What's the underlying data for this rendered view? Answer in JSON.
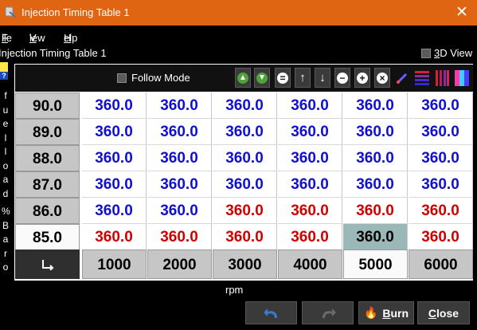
{
  "window": {
    "title": "Injection Timing Table 1"
  },
  "menu": [
    {
      "label": "File",
      "ul": "F",
      "rest": "ile"
    },
    {
      "label": "View",
      "ul": "V",
      "rest": "iew"
    },
    {
      "label": "Help",
      "ul": "H",
      "rest": "elp"
    }
  ],
  "table_name": "Injection Timing Table 1",
  "view3d": {
    "label": "3D View",
    "ul": "3",
    "rest": "D View"
  },
  "follow_mode": "Follow Mode",
  "y_axis_label": [
    "f",
    "u",
    "e",
    "l",
    "l",
    "o",
    "a",
    "d",
    "%",
    "B",
    "a",
    "r",
    "o"
  ],
  "rows": [
    {
      "label": "90.0",
      "cells": [
        "360.0",
        "360.0",
        "360.0",
        "360.0",
        "360.0",
        "360.0"
      ]
    },
    {
      "label": "89.0",
      "cells": [
        "360.0",
        "360.0",
        "360.0",
        "360.0",
        "360.0",
        "360.0"
      ]
    },
    {
      "label": "88.0",
      "cells": [
        "360.0",
        "360.0",
        "360.0",
        "360.0",
        "360.0",
        "360.0"
      ]
    },
    {
      "label": "87.0",
      "cells": [
        "360.0",
        "360.0",
        "360.0",
        "360.0",
        "360.0",
        "360.0"
      ]
    },
    {
      "label": "86.0",
      "cells": [
        "360.0",
        "360.0",
        "360.0",
        "360.0",
        "360.0",
        "360.0"
      ]
    },
    {
      "label": "85.0",
      "cells": [
        "360.0",
        "360.0",
        "360.0",
        "360.0",
        "360.0",
        "360.0"
      ]
    }
  ],
  "cell_colors": [
    [
      "blue",
      "blue",
      "blue",
      "blue",
      "blue",
      "blue"
    ],
    [
      "blue",
      "blue",
      "blue",
      "blue",
      "blue",
      "blue"
    ],
    [
      "blue",
      "blue",
      "blue",
      "blue",
      "blue",
      "blue"
    ],
    [
      "blue",
      "blue",
      "blue",
      "blue",
      "blue",
      "blue"
    ],
    [
      "blue",
      "blue",
      "red",
      "red",
      "red",
      "red"
    ],
    [
      "red",
      "red",
      "red",
      "red",
      "sel",
      "red"
    ]
  ],
  "columns": [
    "1000",
    "2000",
    "3000",
    "4000",
    "5000",
    "6000"
  ],
  "x_axis_label": "rpm",
  "buttons": {
    "burn": "Burn",
    "burn_ul": "B",
    "burn_rest": "urn",
    "close": "Close",
    "close_ul": "C",
    "close_rest": "lose"
  },
  "colors": {
    "title_bar": "#e06512",
    "cell_blue": "#1010d0",
    "cell_red": "#d00000",
    "selected_cell": "#9bb8b8"
  }
}
